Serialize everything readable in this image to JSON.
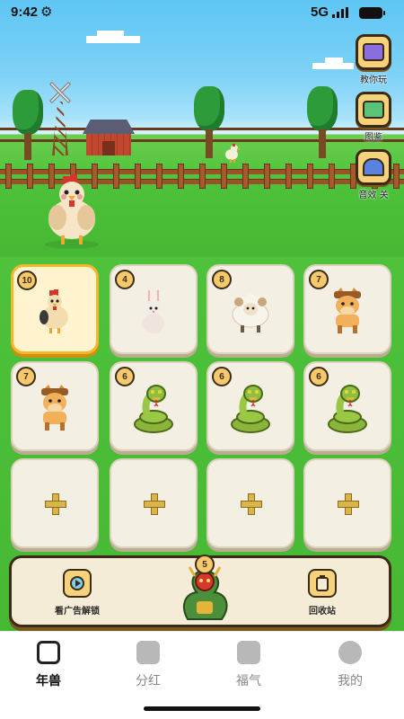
{
  "status_bar": {
    "time": "9:42",
    "network": "5G"
  },
  "side_buttons": [
    {
      "label": "教你玩",
      "icon": "tutorial-icon"
    },
    {
      "label": "图鉴",
      "icon": "handbook-icon"
    },
    {
      "label": "音效 关",
      "icon": "sound-off-icon"
    }
  ],
  "grid": [
    {
      "level": "10",
      "animal": "rooster",
      "selected": true
    },
    {
      "level": "4",
      "animal": "rabbit"
    },
    {
      "level": "8",
      "animal": "sheep"
    },
    {
      "level": "7",
      "animal": "horse"
    },
    {
      "level": "7",
      "animal": "horse"
    },
    {
      "level": "6",
      "animal": "snake"
    },
    {
      "level": "6",
      "animal": "snake"
    },
    {
      "level": "6",
      "animal": "snake"
    },
    {
      "level": "",
      "animal": "empty"
    },
    {
      "level": "",
      "animal": "empty"
    },
    {
      "level": "",
      "animal": "empty"
    },
    {
      "level": "",
      "animal": "empty"
    }
  ],
  "panel": {
    "left_label": "看广告解锁",
    "right_label": "回收站",
    "dragon_level": "5"
  },
  "tabs": [
    {
      "label": "年兽",
      "active": true
    },
    {
      "label": "分红"
    },
    {
      "label": "福气"
    },
    {
      "label": "我的"
    }
  ],
  "colors": {
    "accent": "#f3b727",
    "card": "#f4efe3",
    "grass": "#4ec23a",
    "sky": "#5fc6f4"
  }
}
